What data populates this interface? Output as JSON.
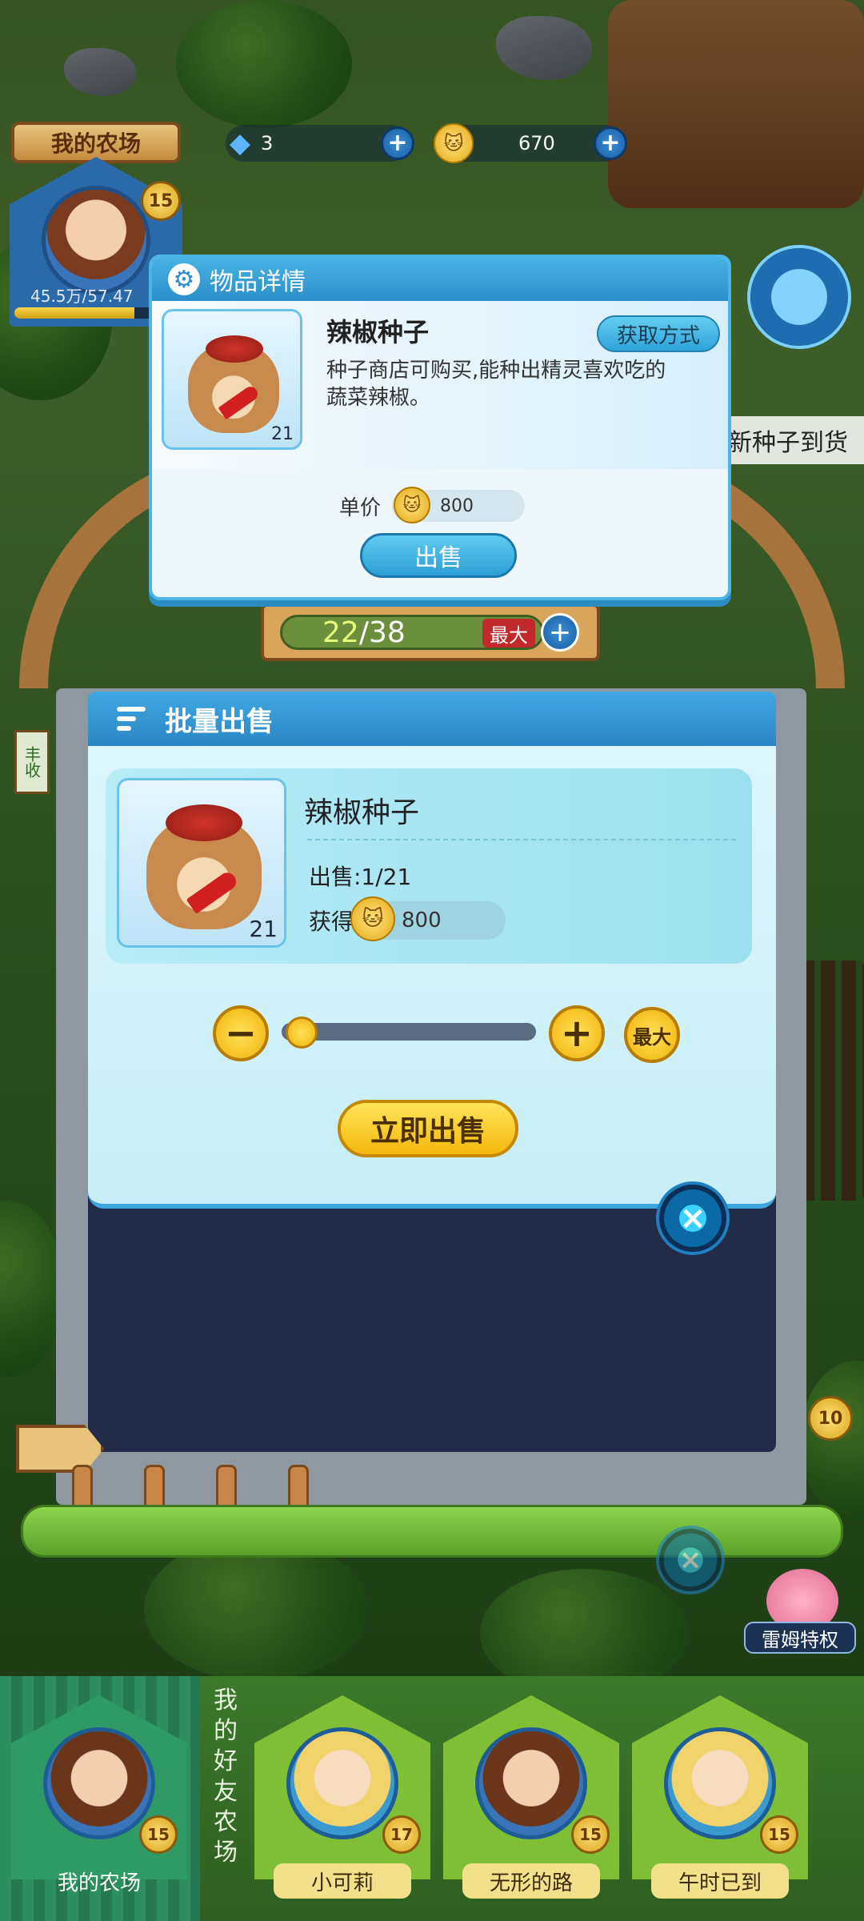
{
  "hud": {
    "farm_title": "我的农场",
    "level": "15",
    "exp_text": "45.5万/57.47",
    "exp_progress": 0.79,
    "gems": "3",
    "coins": "670",
    "plus_symbol": "+",
    "gem_icon": "diamond-icon",
    "coin_icon": "cat-coin-icon",
    "news_text": "新种子到货"
  },
  "item_detail": {
    "header": "物品详情",
    "item_name": "辣椒种子",
    "quantity": "21",
    "description": "种子商店可购买,能种出精灵喜欢吃的蔬菜辣椒。",
    "acquire_label": "获取方式",
    "price_label": "单价",
    "price": "800",
    "sell_label": "出售"
  },
  "capacity": {
    "current": "22",
    "separator": "/",
    "total": "38",
    "max_label": "最大",
    "plus_symbol": "+"
  },
  "bulk_sell": {
    "header": "批量出售",
    "item_name": "辣椒种子",
    "quantity": "21",
    "sell_count_label": "出售:1/21",
    "earn_label": "获得",
    "earn_value": "800",
    "minus_symbol": "−",
    "plus_symbol": "+",
    "max_label": "最大",
    "slider_fraction": 0.05,
    "sell_now_label": "立即出售",
    "close_symbol": "×"
  },
  "side": {
    "remu_label": "雷姆特权",
    "side_badge": "10",
    "harvest_sign": "丰收"
  },
  "bottom": {
    "friends_label": "我的好友农场",
    "slots": [
      {
        "name": "我的农场",
        "level": "15"
      },
      {
        "name": "小可莉",
        "level": "17"
      },
      {
        "name": "无形的路",
        "level": "15"
      },
      {
        "name": "午时已到",
        "level": "15"
      }
    ]
  },
  "colors": {
    "panel_blue": "#3fa8e2",
    "button_yellow": "#f4b80a",
    "panel_dark": "#222b48"
  }
}
